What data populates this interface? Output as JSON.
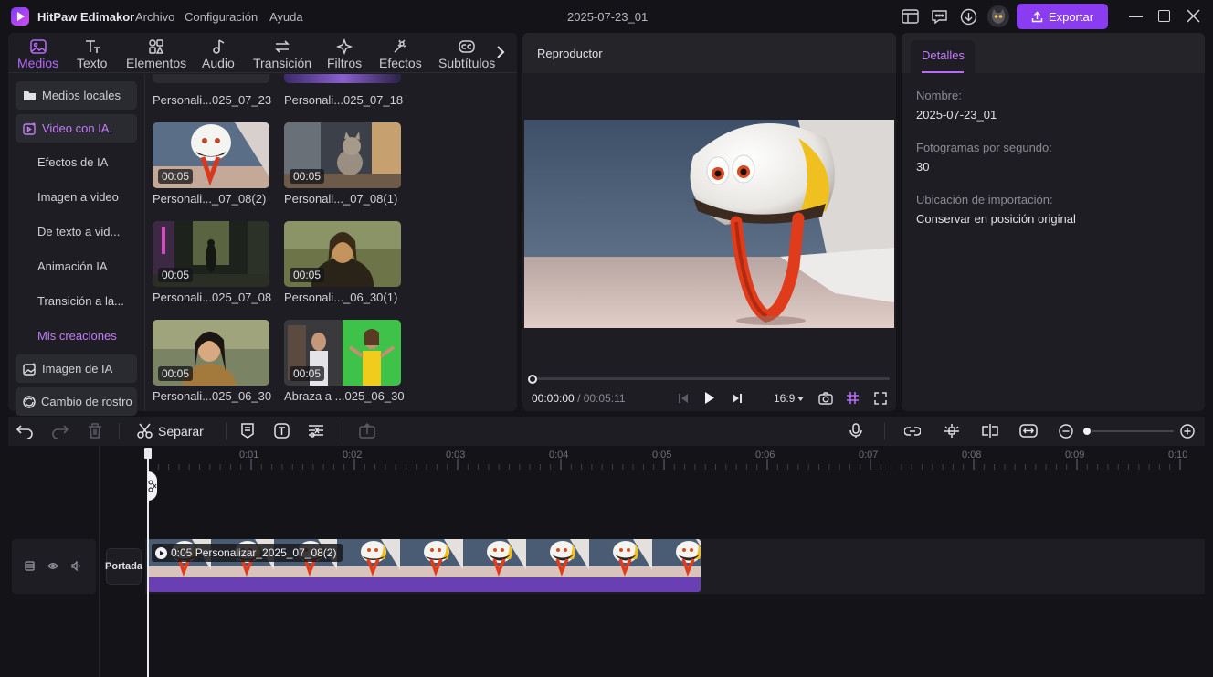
{
  "app": {
    "name": "HitPaw Edimakor",
    "project_title": "2025-07-23_01"
  },
  "menu": [
    "Archivo",
    "Configuración",
    "Ayuda"
  ],
  "title_icons": [
    "layout-icon",
    "feedback-icon",
    "download-icon",
    "avatar"
  ],
  "export_label": "Exportar",
  "colors": {
    "accent": "#8a3df0",
    "accent_text": "#b66af7",
    "clip_bar": "#6b3fb4",
    "bg": "#131318",
    "panel": "#1d1d23"
  },
  "tabs": [
    {
      "label": "Medios",
      "icon": "media-icon",
      "active": true
    },
    {
      "label": "Texto",
      "icon": "text-icon"
    },
    {
      "label": "Elementos",
      "icon": "elements-icon"
    },
    {
      "label": "Audio",
      "icon": "audio-icon"
    },
    {
      "label": "Transición",
      "icon": "transition-icon"
    },
    {
      "label": "Filtros",
      "icon": "filters-icon"
    },
    {
      "label": "Efectos",
      "icon": "effects-icon"
    },
    {
      "label": "Subtítulos",
      "icon": "subtitles-icon"
    }
  ],
  "sidebar": {
    "items": [
      {
        "label": "Medios locales",
        "icon": "folder-icon"
      },
      {
        "label": "Video con IA.",
        "icon": "ai-video-icon",
        "active": true
      },
      {
        "label": "Efectos de IA"
      },
      {
        "label": "Imagen a video"
      },
      {
        "label": "De texto a vid..."
      },
      {
        "label": "Animación IA"
      },
      {
        "label": "Transición a la..."
      },
      {
        "label": "Mis creaciones",
        "active": true
      },
      {
        "label": "Imagen de IA",
        "icon": "ai-image-icon"
      },
      {
        "label": "Cambio de rostro",
        "icon": "face-swap-icon"
      }
    ]
  },
  "media": {
    "top_labels": [
      "Personali...025_07_23",
      "Personali...025_07_18"
    ],
    "items": [
      {
        "duration": "00:05",
        "label": "Personali..._07_08(2)"
      },
      {
        "duration": "00:05",
        "label": "Personali..._07_08(1)"
      },
      {
        "duration": "00:05",
        "label": "Personali...025_07_08"
      },
      {
        "duration": "00:05",
        "label": "Personali..._06_30(1)"
      },
      {
        "duration": "00:05",
        "label": "Personali...025_06_30"
      },
      {
        "duration": "00:05",
        "label": "Abraza a ...025_06_30"
      }
    ]
  },
  "player": {
    "title": "Reproductor",
    "current_time": "00:00:00",
    "separator": "/",
    "total_time": "00:05:11",
    "aspect_ratio": "16:9",
    "progress": 0
  },
  "details": {
    "tab": "Detalles",
    "fields": [
      {
        "label": "Nombre:",
        "value": "2025-07-23_01"
      },
      {
        "label": "Fotogramas por segundo:",
        "value": "30"
      },
      {
        "label": "Ubicación de importación:",
        "value": "Conservar en posición original"
      }
    ]
  },
  "timeline": {
    "split_label": "Separar",
    "ruler": [
      "0:01",
      "0:02",
      "0:03",
      "0:04",
      "0:05",
      "0:06",
      "0:07",
      "0:08",
      "0:09",
      "0:10"
    ],
    "cover_label": "Portada",
    "clip_label": "0:05 Personalizar_2025_07_08(2)",
    "zoom_level": 0.0
  }
}
